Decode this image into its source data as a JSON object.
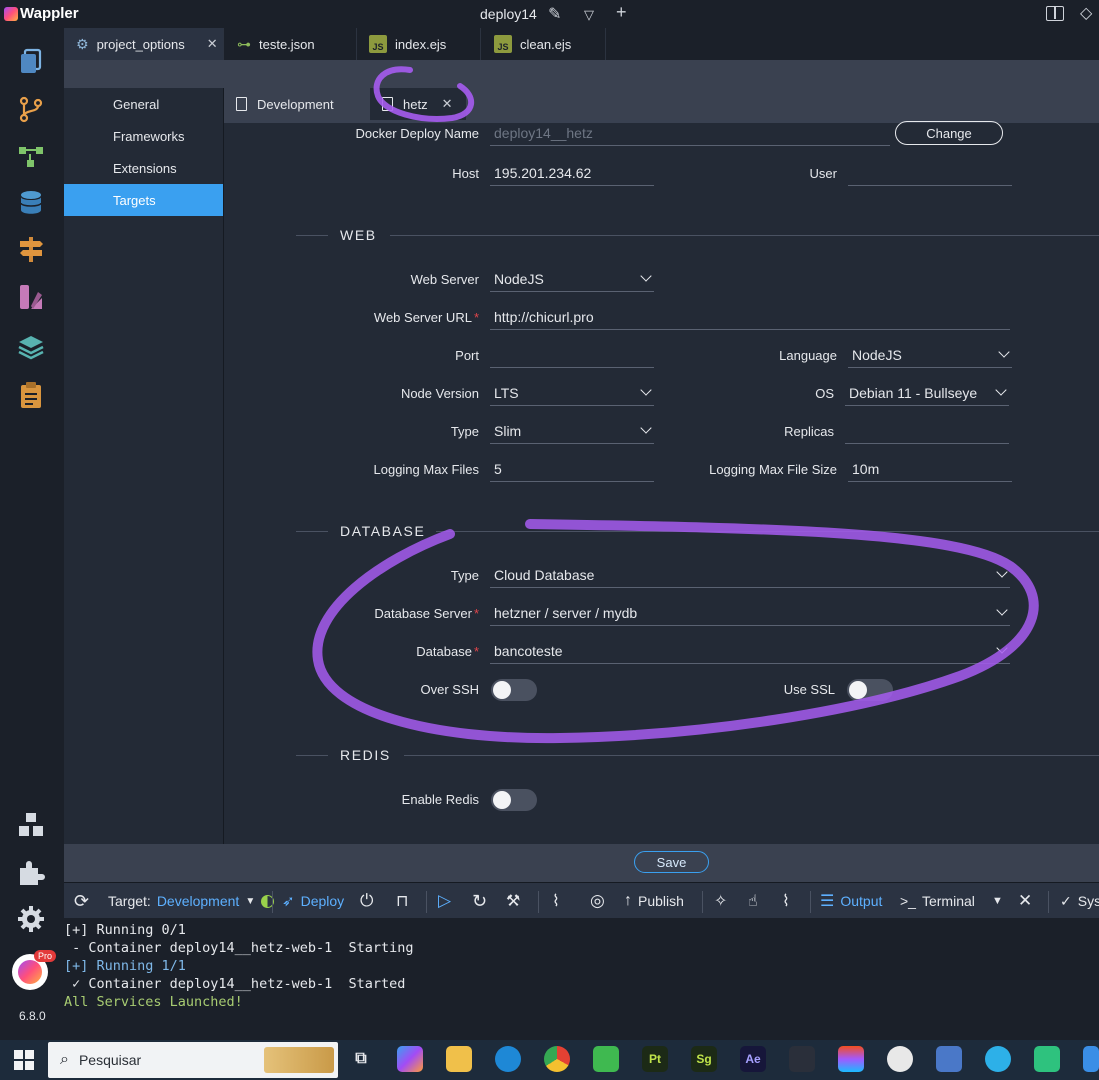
{
  "titlebar": {
    "app_name": "Wappler",
    "project": "deploy14"
  },
  "file_tabs": [
    {
      "label": "project_options",
      "close": "✕"
    },
    {
      "label": "teste.json"
    },
    {
      "label": "index.ejs",
      "badge": "JS"
    },
    {
      "label": "clean.ejs",
      "badge": "JS"
    }
  ],
  "options_nav": [
    "General",
    "Frameworks",
    "Extensions",
    "Targets"
  ],
  "target_tabs": [
    {
      "label": "Development"
    },
    {
      "label": "hetz",
      "close": "✕"
    }
  ],
  "top": {
    "docker_deploy_name_label": "Docker Deploy Name",
    "docker_deploy_name_value": "deploy14__hetz",
    "change_button": "Change",
    "host_label": "Host",
    "host_value": "195.201.234.62",
    "user_label": "User",
    "user_value": ""
  },
  "web": {
    "section": "WEB",
    "web_server_label": "Web Server",
    "web_server_value": "NodeJS",
    "web_server_url_label": "Web Server URL",
    "web_server_url_value": "http://chicurl.pro",
    "port_label": "Port",
    "port_value": "",
    "language_label": "Language",
    "language_value": "NodeJS",
    "node_version_label": "Node Version",
    "node_version_value": "LTS",
    "os_label": "OS",
    "os_value": "Debian 11 - Bullseye",
    "type_label": "Type",
    "type_value": "Slim",
    "replicas_label": "Replicas",
    "replicas_value": "",
    "logging_max_files_label": "Logging Max Files",
    "logging_max_files_value": "5",
    "logging_max_file_size_label": "Logging Max File Size",
    "logging_max_file_size_value": "10m"
  },
  "database": {
    "section": "DATABASE",
    "type_label": "Type",
    "type_value": "Cloud Database",
    "server_label": "Database Server",
    "server_value": "hetzner / server / mydb",
    "database_label": "Database",
    "database_value": "bancoteste",
    "over_ssh_label": "Over SSH",
    "use_ssl_label": "Use SSL"
  },
  "redis": {
    "section": "REDIS",
    "enable_label": "Enable Redis"
  },
  "save_label": "Save",
  "bottombar": {
    "target_label": "Target:",
    "target_value": "Development",
    "deploy": "Deploy",
    "publish": "Publish",
    "output": "Output",
    "terminal": "Terminal",
    "sys": "Sys"
  },
  "terminal_lines": [
    "[+] Running 0/1",
    " - Container deploy14__hetz-web-1  Starting",
    "[+] Running 1/1",
    " ✓ Container deploy14__hetz-web-1  Started",
    "All Services Launched!"
  ],
  "version": "6.8.0",
  "pro_badge": "Pro",
  "taskbar": {
    "search_placeholder": "Pesquisar",
    "apps": [
      "Pt",
      "Sg",
      "Ae"
    ]
  },
  "colors": {
    "accent": "#3aa0f0",
    "annotation": "#a65cf0",
    "required": "#e2454b"
  }
}
